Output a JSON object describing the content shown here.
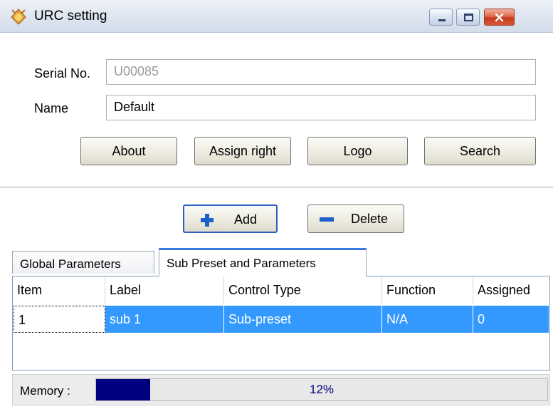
{
  "window": {
    "title": "URC setting"
  },
  "form": {
    "serial_label": "Serial No.",
    "serial_value": "U00085",
    "name_label": "Name",
    "name_value": "Default"
  },
  "buttons": {
    "about": "About",
    "assign_right": "Assign right",
    "logo": "Logo",
    "search": "Search",
    "add": "Add",
    "delete": "Delete"
  },
  "tabs": [
    {
      "label": "Global Parameters",
      "active": false
    },
    {
      "label": "Sub Preset and Parameters",
      "active": true
    }
  ],
  "table": {
    "columns": [
      "Item",
      "Label",
      "Control Type",
      "Function",
      "Assigned"
    ],
    "rows": [
      [
        "1",
        "sub 1",
        "Sub-preset",
        "N/A",
        "0"
      ]
    ]
  },
  "memory": {
    "label": "Memory :",
    "percent_text": "12%",
    "percent": 12
  },
  "colors": {
    "selection": "#3399ff",
    "progress": "#000080",
    "accent": "#1f60c7"
  }
}
